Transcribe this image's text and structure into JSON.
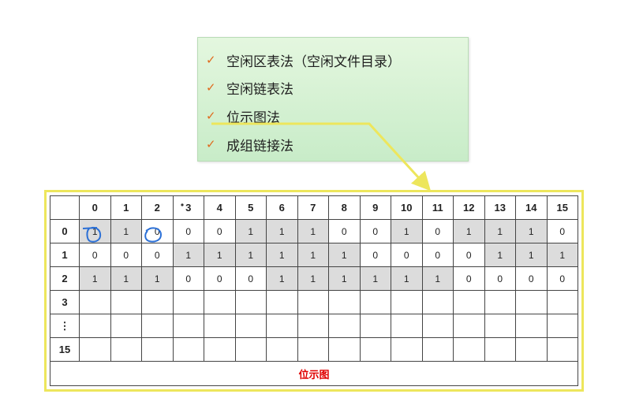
{
  "menu": {
    "items": [
      {
        "check": "✓",
        "label": "空闲区表法（空闲文件目录）"
      },
      {
        "check": "✓",
        "label": "空闲链表法"
      },
      {
        "check": "✓",
        "label": "位示图法"
      },
      {
        "check": "✓",
        "label": "成组链接法"
      }
    ]
  },
  "bitmap": {
    "columns": [
      "0",
      "1",
      "2",
      "3",
      "4",
      "5",
      "6",
      "7",
      "8",
      "9",
      "10",
      "11",
      "12",
      "13",
      "14",
      "15"
    ],
    "rows": [
      {
        "label": "0",
        "bits": [
          "1",
          "1",
          "0",
          "0",
          "0",
          "1",
          "1",
          "1",
          "0",
          "0",
          "1",
          "0",
          "1",
          "1",
          "1",
          "0"
        ]
      },
      {
        "label": "1",
        "bits": [
          "0",
          "0",
          "0",
          "1",
          "1",
          "1",
          "1",
          "1",
          "1",
          "0",
          "0",
          "0",
          "0",
          "1",
          "1",
          "1"
        ]
      },
      {
        "label": "2",
        "bits": [
          "1",
          "1",
          "1",
          "0",
          "0",
          "0",
          "1",
          "1",
          "1",
          "1",
          "1",
          "1",
          "0",
          "0",
          "0",
          "0"
        ]
      },
      {
        "label": "3",
        "bits": [
          "",
          "",
          "",
          "",
          "",
          "",
          "",
          "",
          "",
          "",
          "",
          "",
          "",
          "",
          "",
          ""
        ]
      },
      {
        "label": "⋮",
        "bits": [
          "",
          "",
          "",
          "",
          "",
          "",
          "",
          "",
          "",
          "",
          "",
          "",
          "",
          "",
          "",
          ""
        ]
      },
      {
        "label": "15",
        "bits": [
          "",
          "",
          "",
          "",
          "",
          "",
          "",
          "",
          "",
          "",
          "",
          "",
          "",
          "",
          "",
          ""
        ]
      }
    ],
    "caption": "位示图"
  },
  "colors": {
    "accent_yellow": "#ede65c",
    "check_orange": "#e06a1d",
    "caption_red": "#e00000",
    "annotation_blue": "#2a6fd6",
    "set_bit_fill": "#dcdcdc"
  }
}
